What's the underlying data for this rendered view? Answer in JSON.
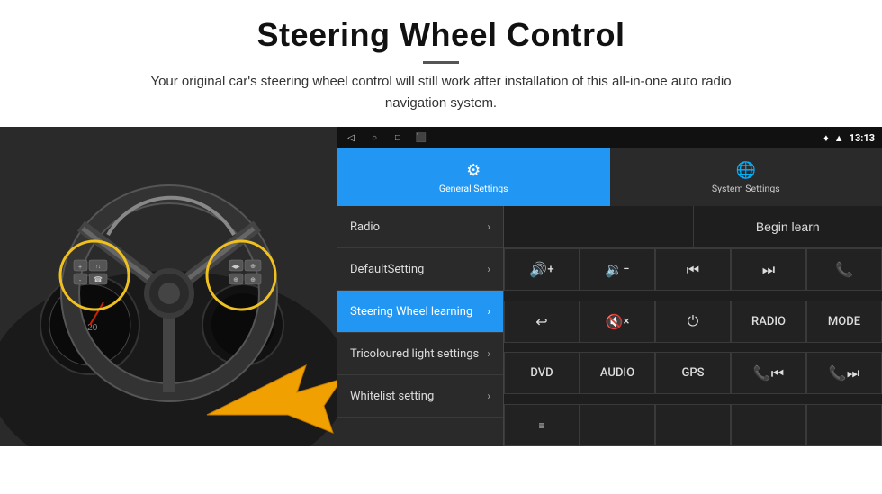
{
  "header": {
    "title": "Steering Wheel Control",
    "subtitle": "Your original car's steering wheel control will still work after installation of this all-in-one auto radio navigation system."
  },
  "android": {
    "statusBar": {
      "time": "13:13",
      "navIcons": [
        "◁",
        "○",
        "□",
        "⬛"
      ]
    },
    "tabs": [
      {
        "id": "general",
        "label": "General Settings",
        "icon": "⚙",
        "active": true
      },
      {
        "id": "system",
        "label": "System Settings",
        "icon": "🌐",
        "active": false
      }
    ],
    "menuItems": [
      {
        "id": "radio",
        "label": "Radio",
        "active": false
      },
      {
        "id": "default",
        "label": "DefaultSetting",
        "active": false
      },
      {
        "id": "steering",
        "label": "Steering Wheel learning",
        "active": true
      },
      {
        "id": "tricoloured",
        "label": "Tricoloured light settings",
        "active": false
      },
      {
        "id": "whitelist",
        "label": "Whitelist setting",
        "active": false
      }
    ],
    "beginLearnLabel": "Begin learn",
    "controlButtons": {
      "row1": [
        {
          "id": "vol-up",
          "label": "🔊+",
          "type": "icon"
        },
        {
          "id": "vol-down",
          "label": "🔇-",
          "type": "icon"
        },
        {
          "id": "prev-track",
          "label": "⏮",
          "type": "icon"
        },
        {
          "id": "next-track",
          "label": "⏭",
          "type": "icon"
        },
        {
          "id": "phone",
          "label": "📞",
          "type": "icon"
        }
      ],
      "row2": [
        {
          "id": "hang-up",
          "label": "↩",
          "type": "icon"
        },
        {
          "id": "mute",
          "label": "🔇×",
          "type": "icon"
        },
        {
          "id": "power",
          "label": "⏻",
          "type": "icon"
        },
        {
          "id": "radio-btn",
          "label": "RADIO",
          "type": "text"
        },
        {
          "id": "mode-btn",
          "label": "MODE",
          "type": "text"
        }
      ],
      "row3": [
        {
          "id": "dvd",
          "label": "DVD",
          "type": "text"
        },
        {
          "id": "audio",
          "label": "AUDIO",
          "type": "text"
        },
        {
          "id": "gps",
          "label": "GPS",
          "type": "text"
        },
        {
          "id": "phone-prev",
          "label": "📞⏮",
          "type": "icon"
        },
        {
          "id": "phone-next",
          "label": "📞⏭",
          "type": "icon"
        }
      ],
      "row4": [
        {
          "id": "list-icon",
          "label": "≡",
          "type": "icon"
        }
      ]
    }
  }
}
